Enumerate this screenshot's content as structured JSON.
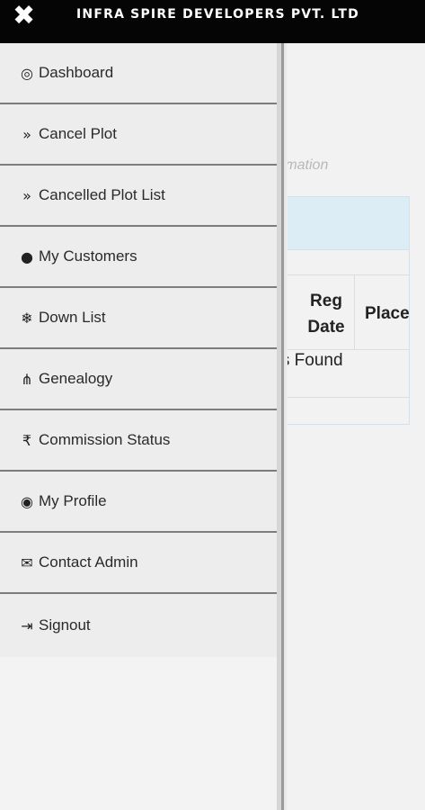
{
  "header": {
    "close_icon": "close-icon",
    "title": "INFRA SPIRE DEVELOPERS PVT. LTD"
  },
  "background": {
    "hint_text": "rmation",
    "table_headers": [
      "Reg Date",
      "Placem"
    ],
    "table_header_reg": "Reg\nDate",
    "table_header_place": "Placem",
    "empty_text": "rds Found"
  },
  "menu": {
    "items": [
      {
        "label": "Dashboard",
        "icon": "dashboard-icon",
        "glyph": "◎"
      },
      {
        "label": "Cancel Plot",
        "icon": "double-chevron-right-icon",
        "glyph": "»"
      },
      {
        "label": "Cancelled Plot List",
        "icon": "double-chevron-right-icon",
        "glyph": "»"
      },
      {
        "label": "My Customers",
        "icon": "user-icon",
        "glyph": "●"
      },
      {
        "label": "Down List",
        "icon": "snowflake-icon",
        "glyph": "❄"
      },
      {
        "label": "Genealogy",
        "icon": "sitemap-icon",
        "glyph": "⋔"
      },
      {
        "label": "Commission Status",
        "icon": "rupee-icon",
        "glyph": "₹"
      },
      {
        "label": "My Profile",
        "icon": "user-circle-icon",
        "glyph": "◉"
      },
      {
        "label": "Contact Admin",
        "icon": "envelope-icon",
        "glyph": "✉"
      },
      {
        "label": "Signout",
        "icon": "sign-out-icon",
        "glyph": "⇥"
      }
    ]
  }
}
